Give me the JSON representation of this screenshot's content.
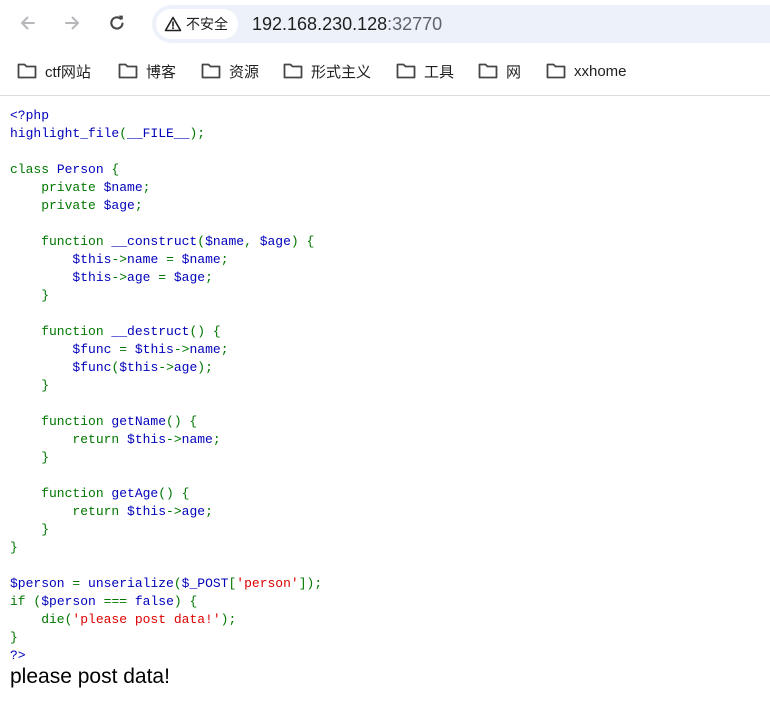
{
  "address_bar": {
    "security_label": "不安全",
    "url_host": "192.168.230.128",
    "url_port": ":32770"
  },
  "bookmarks": [
    {
      "label": "ctf网站"
    },
    {
      "label": "博客"
    },
    {
      "label": "资源"
    },
    {
      "label": "形式主义"
    },
    {
      "label": "工具"
    },
    {
      "label": "网"
    },
    {
      "label": "xxhome"
    }
  ],
  "code_lines": [
    [
      {
        "t": "<?php",
        "c": "b"
      }
    ],
    [
      {
        "t": "highlight_file",
        "c": "b"
      },
      {
        "t": "(",
        "c": "k"
      },
      {
        "t": "__FILE__",
        "c": "b"
      },
      {
        "t": ");",
        "c": "k"
      }
    ],
    [],
    [
      {
        "t": "class ",
        "c": "k"
      },
      {
        "t": "Person ",
        "c": "b"
      },
      {
        "t": "{",
        "c": "k"
      }
    ],
    [
      {
        "t": "    private ",
        "c": "k"
      },
      {
        "t": "$name",
        "c": "b"
      },
      {
        "t": ";",
        "c": "k"
      }
    ],
    [
      {
        "t": "    private ",
        "c": "k"
      },
      {
        "t": "$age",
        "c": "b"
      },
      {
        "t": ";",
        "c": "k"
      }
    ],
    [],
    [
      {
        "t": "    function ",
        "c": "k"
      },
      {
        "t": "__construct",
        "c": "b"
      },
      {
        "t": "(",
        "c": "k"
      },
      {
        "t": "$name",
        "c": "b"
      },
      {
        "t": ", ",
        "c": "k"
      },
      {
        "t": "$age",
        "c": "b"
      },
      {
        "t": ") {",
        "c": "k"
      }
    ],
    [
      {
        "t": "        ",
        "c": "k"
      },
      {
        "t": "$this",
        "c": "b"
      },
      {
        "t": "->",
        "c": "k"
      },
      {
        "t": "name ",
        "c": "b"
      },
      {
        "t": "= ",
        "c": "k"
      },
      {
        "t": "$name",
        "c": "b"
      },
      {
        "t": ";",
        "c": "k"
      }
    ],
    [
      {
        "t": "        ",
        "c": "k"
      },
      {
        "t": "$this",
        "c": "b"
      },
      {
        "t": "->",
        "c": "k"
      },
      {
        "t": "age ",
        "c": "b"
      },
      {
        "t": "= ",
        "c": "k"
      },
      {
        "t": "$age",
        "c": "b"
      },
      {
        "t": ";",
        "c": "k"
      }
    ],
    [
      {
        "t": "    }",
        "c": "k"
      }
    ],
    [],
    [
      {
        "t": "    function ",
        "c": "k"
      },
      {
        "t": "__destruct",
        "c": "b"
      },
      {
        "t": "() {",
        "c": "k"
      }
    ],
    [
      {
        "t": "        ",
        "c": "k"
      },
      {
        "t": "$func ",
        "c": "b"
      },
      {
        "t": "= ",
        "c": "k"
      },
      {
        "t": "$this",
        "c": "b"
      },
      {
        "t": "->",
        "c": "k"
      },
      {
        "t": "name",
        "c": "b"
      },
      {
        "t": ";",
        "c": "k"
      }
    ],
    [
      {
        "t": "        ",
        "c": "k"
      },
      {
        "t": "$func",
        "c": "b"
      },
      {
        "t": "(",
        "c": "k"
      },
      {
        "t": "$this",
        "c": "b"
      },
      {
        "t": "->",
        "c": "k"
      },
      {
        "t": "age",
        "c": "b"
      },
      {
        "t": ");",
        "c": "k"
      }
    ],
    [
      {
        "t": "    }",
        "c": "k"
      }
    ],
    [],
    [
      {
        "t": "    function ",
        "c": "k"
      },
      {
        "t": "getName",
        "c": "b"
      },
      {
        "t": "() {",
        "c": "k"
      }
    ],
    [
      {
        "t": "        return ",
        "c": "k"
      },
      {
        "t": "$this",
        "c": "b"
      },
      {
        "t": "->",
        "c": "k"
      },
      {
        "t": "name",
        "c": "b"
      },
      {
        "t": ";",
        "c": "k"
      }
    ],
    [
      {
        "t": "    }",
        "c": "k"
      }
    ],
    [],
    [
      {
        "t": "    function ",
        "c": "k"
      },
      {
        "t": "getAge",
        "c": "b"
      },
      {
        "t": "() {",
        "c": "k"
      }
    ],
    [
      {
        "t": "        return ",
        "c": "k"
      },
      {
        "t": "$this",
        "c": "b"
      },
      {
        "t": "->",
        "c": "k"
      },
      {
        "t": "age",
        "c": "b"
      },
      {
        "t": ";",
        "c": "k"
      }
    ],
    [
      {
        "t": "    }",
        "c": "k"
      }
    ],
    [
      {
        "t": "}",
        "c": "k"
      }
    ],
    [],
    [
      {
        "t": "$person ",
        "c": "b"
      },
      {
        "t": "= ",
        "c": "k"
      },
      {
        "t": "unserialize",
        "c": "b"
      },
      {
        "t": "(",
        "c": "k"
      },
      {
        "t": "$_POST",
        "c": "b"
      },
      {
        "t": "[",
        "c": "k"
      },
      {
        "t": "'person'",
        "c": "s"
      },
      {
        "t": "]);",
        "c": "k"
      }
    ],
    [
      {
        "t": "if (",
        "c": "k"
      },
      {
        "t": "$person ",
        "c": "b"
      },
      {
        "t": "=== ",
        "c": "k"
      },
      {
        "t": "false",
        "c": "b"
      },
      {
        "t": ") {",
        "c": "k"
      }
    ],
    [
      {
        "t": "    die",
        "c": "k"
      },
      {
        "t": "(",
        "c": "k"
      },
      {
        "t": "'please post data!'",
        "c": "s"
      },
      {
        "t": ");",
        "c": "k"
      }
    ],
    [
      {
        "t": "}",
        "c": "k"
      }
    ],
    [
      {
        "t": "?>",
        "c": "b"
      }
    ]
  ],
  "output_text": "please post data!"
}
